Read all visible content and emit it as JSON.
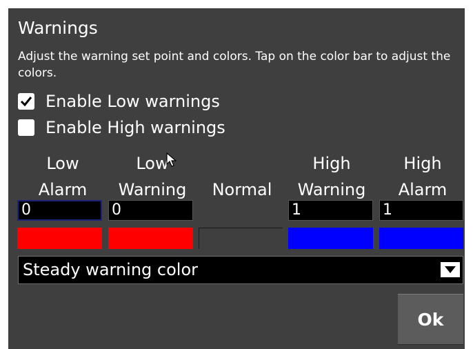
{
  "dialog": {
    "title": "Warnings",
    "description": "Adjust the warning set point and colors. Tap on the color bar to adjust the colors."
  },
  "checkboxes": {
    "low": {
      "label": "Enable Low warnings",
      "checked": true
    },
    "high": {
      "label": "Enable High warnings",
      "checked": false
    }
  },
  "columns": [
    {
      "line1": "Low",
      "line2": "Alarm"
    },
    {
      "line1": "Low",
      "line2": "Warning"
    },
    {
      "line1": "",
      "line2": "Normal"
    },
    {
      "line1": "High",
      "line2": "Warning"
    },
    {
      "line1": "High",
      "line2": "Alarm"
    }
  ],
  "fields": {
    "low_alarm": "0",
    "low_warning": "0",
    "high_warning": "1",
    "high_alarm": "1"
  },
  "colors": {
    "low_alarm": "#ff0000",
    "low_warning": "#ff0000",
    "normal": "#3f3f3f",
    "high_warning": "#0000ff",
    "high_alarm": "#0000ff"
  },
  "dropdown": {
    "selected": "Steady warning color"
  },
  "buttons": {
    "ok": "Ok"
  }
}
